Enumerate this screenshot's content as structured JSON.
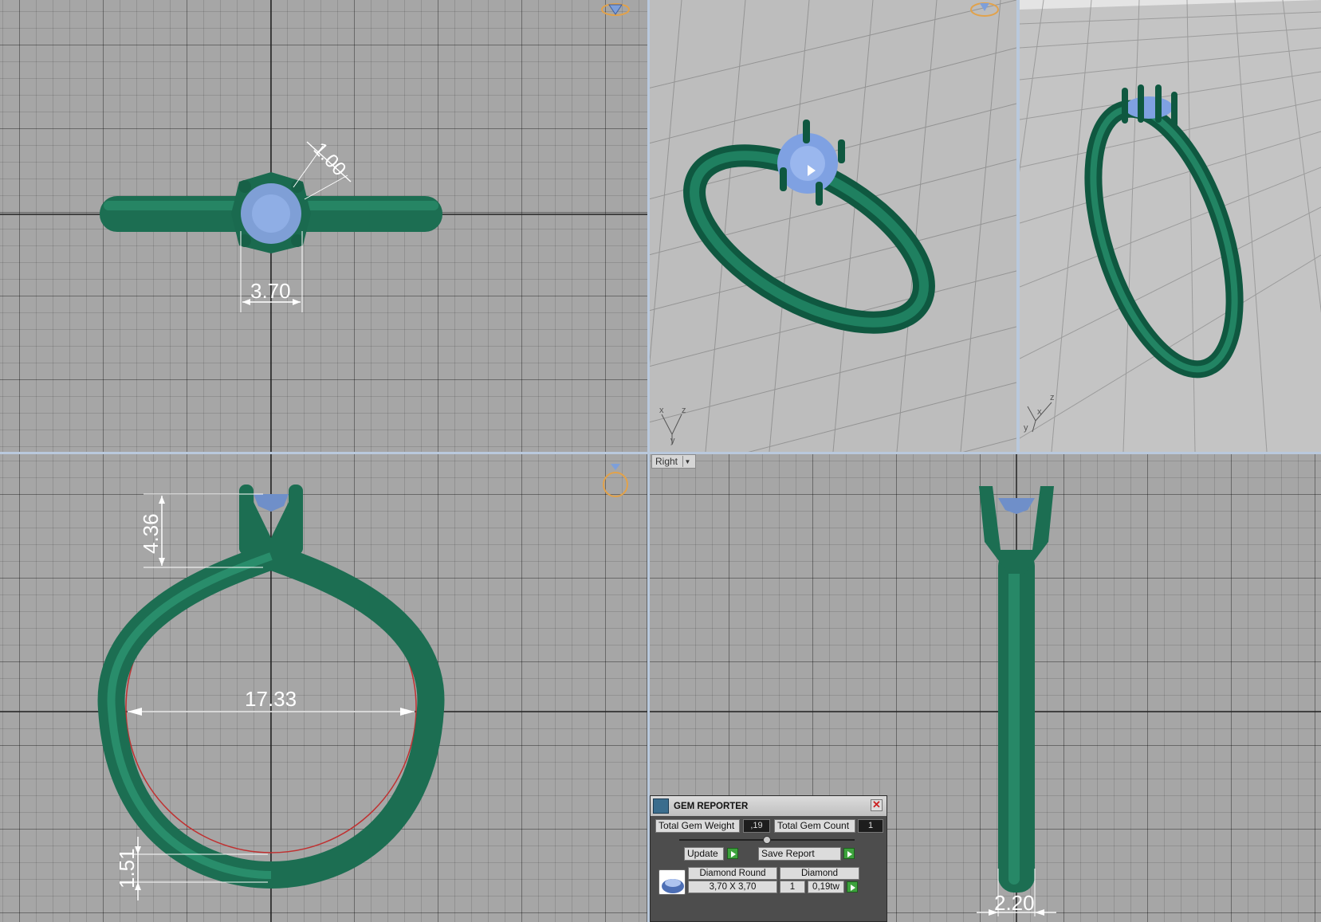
{
  "viewports": {
    "top": {
      "dims": {
        "prong": "1.00",
        "gem_width": "3.70"
      }
    },
    "front": {
      "dims": {
        "setting_height": "4.36",
        "inner_diameter": "17.33",
        "band_thickness": "1.51"
      }
    },
    "right": {
      "label": "Right",
      "dims": {
        "band_width": "2.20"
      }
    },
    "persp1": {
      "axes": {
        "x": "x",
        "y": "y",
        "z": "z"
      }
    },
    "persp2": {
      "axes": {
        "x": "x",
        "y": "y",
        "z": "z"
      }
    }
  },
  "colors": {
    "metal": "#1f7a5b",
    "metal_dark": "#0e4d38",
    "gem": "#8fb0e4",
    "grid_bg": "#a6a6a6",
    "dim_line": "#ffffff",
    "view_cube": "#e2a24a"
  },
  "gem_reporter": {
    "title": "GEM REPORTER",
    "total_weight_label": "Total Gem Weight",
    "total_weight_value": ",19",
    "total_count_label": "Total Gem Count",
    "total_count_value": "1",
    "update_label": "Update",
    "save_report_label": "Save Report",
    "columns": [
      "Diamond Round",
      "Diamond"
    ],
    "row": {
      "size": "3,70 X 3,70",
      "count": "1",
      "weight": "0,19tw"
    }
  },
  "icons": [
    "view-cube-icon",
    "ring-nav-icon",
    "gem-reporter-icon",
    "close-icon",
    "go-arrow-icon",
    "dropdown-arrow-icon",
    "gem-thumbnail-icon"
  ]
}
